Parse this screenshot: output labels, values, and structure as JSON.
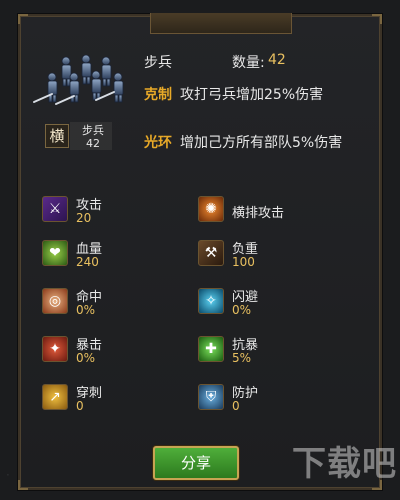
{
  "colors": {
    "accent_tag": "#e8a928",
    "value_gold": "#e8c060",
    "text": "#e8e8e8",
    "button_green": "#3c9a2b"
  },
  "unit": {
    "name": "步兵",
    "quantity_label": "数量:",
    "quantity": "42",
    "badge_symbol": "横",
    "badge_name": "步兵",
    "badge_count": "42"
  },
  "effects": [
    {
      "tag": "克制",
      "text": "攻打弓兵增加25%伤害"
    },
    {
      "tag": "光环",
      "text": "增加己方所有部队5%伤害"
    }
  ],
  "stats_left": [
    {
      "name": "攻击",
      "value": "20",
      "icon": "sword-icon"
    },
    {
      "name": "血量",
      "value": "240",
      "icon": "heart-icon"
    },
    {
      "name": "命中",
      "value": "0%",
      "icon": "target-icon"
    },
    {
      "name": "暴击",
      "value": "0%",
      "icon": "crit-icon"
    },
    {
      "name": "穿刺",
      "value": "0",
      "icon": "pierce-icon"
    }
  ],
  "stats_right": [
    {
      "name": "横排攻击",
      "value": "",
      "icon": "row-attack-icon"
    },
    {
      "name": "负重",
      "value": "100",
      "icon": "cart-icon"
    },
    {
      "name": "闪避",
      "value": "0%",
      "icon": "dodge-icon"
    },
    {
      "name": "抗暴",
      "value": "5%",
      "icon": "anti-crit-icon"
    },
    {
      "name": "防护",
      "value": "0",
      "icon": "shield-icon"
    }
  ],
  "share_label": "分享",
  "watermark": "下载吧"
}
